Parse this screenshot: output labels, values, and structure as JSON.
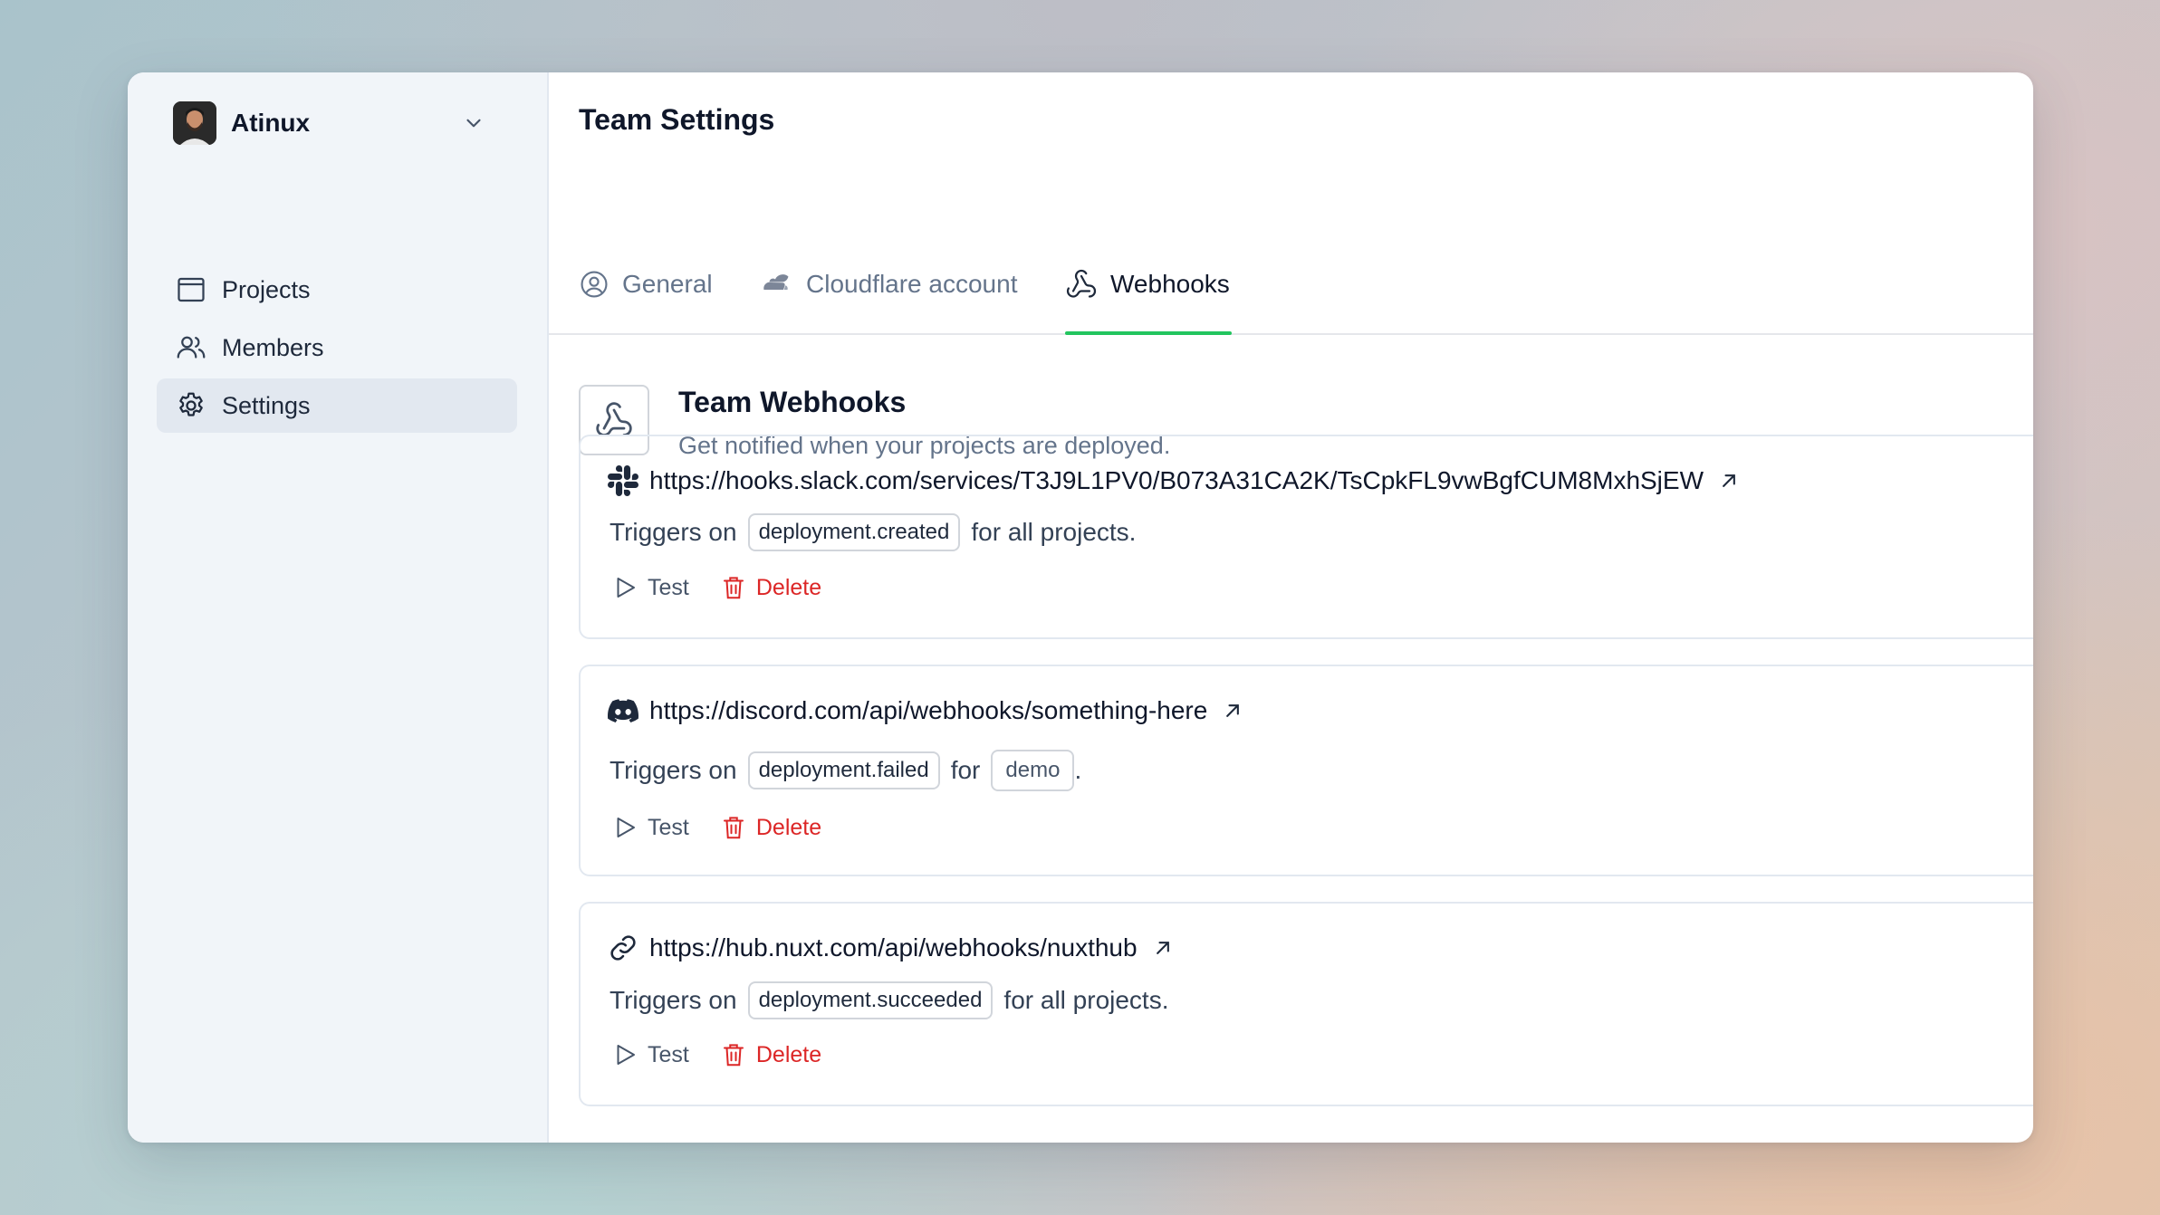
{
  "team": {
    "name": "Atinux"
  },
  "sidebar": {
    "items": [
      {
        "label": "Projects",
        "icon": "projects-icon"
      },
      {
        "label": "Members",
        "icon": "members-icon"
      },
      {
        "label": "Settings",
        "icon": "gear-icon",
        "active": true
      }
    ]
  },
  "header": {
    "title": "Team Settings"
  },
  "tabs": [
    {
      "label": "General",
      "icon": "user-circle-icon"
    },
    {
      "label": "Cloudflare account",
      "icon": "cloudflare-icon"
    },
    {
      "label": "Webhooks",
      "icon": "webhook-icon",
      "active": true
    }
  ],
  "section": {
    "title": "Team Webhooks",
    "description": "Get notified when your projects are deployed."
  },
  "webhooks": [
    {
      "service_icon": "slack-icon",
      "url": "https://hooks.slack.com/services/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",
      "prefix": "Triggers on",
      "event": "deployment.created",
      "middle": "for all projects.",
      "project": "",
      "suffix": ""
    },
    {
      "service_icon": "discord-icon",
      "url": "https://discord.com/api/webhooks/something-here",
      "prefix": "Triggers on",
      "event": "deployment.failed",
      "middle": "for",
      "project": "demo",
      "suffix": "."
    },
    {
      "service_icon": "link-icon",
      "url": "https://hub.nuxt.com/api/webhooks/nuxthub",
      "prefix": "Triggers on",
      "event": "deployment.succeeded",
      "middle": "for all projects.",
      "project": "",
      "suffix": ""
    }
  ],
  "actions": {
    "test_label": "Test",
    "delete_label": "Delete"
  },
  "colors": {
    "accent": "#22c55e",
    "danger": "#dc2626",
    "sidebar_bg": "#f1f5f9"
  }
}
